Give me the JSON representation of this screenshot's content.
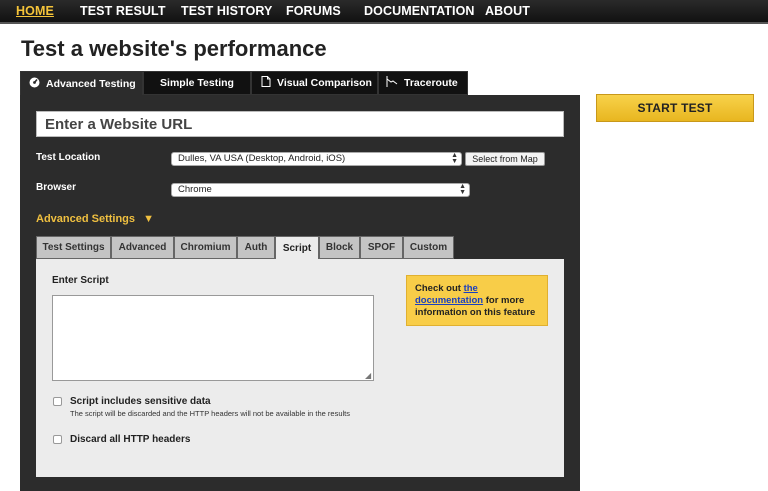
{
  "nav": {
    "items": [
      "HOME",
      "TEST RESULT",
      "TEST HISTORY",
      "FORUMS",
      "DOCUMENTATION",
      "ABOUT"
    ]
  },
  "page": {
    "title": "Test a website's performance"
  },
  "main_tabs": [
    {
      "label": "Advanced Testing",
      "icon": "gauge-icon",
      "active": true
    },
    {
      "label": "Simple Testing",
      "icon": "",
      "active": false
    },
    {
      "label": "Visual Comparison",
      "icon": "document-icon",
      "active": false
    },
    {
      "label": "Traceroute",
      "icon": "traceroute-icon",
      "active": false
    }
  ],
  "form": {
    "url_placeholder": "Enter a Website URL",
    "location_label": "Test Location",
    "location_value": "Dulles, VA USA (Desktop, Android, iOS)",
    "select_from_map": "Select from Map",
    "browser_label": "Browser",
    "browser_value": "Chrome",
    "advanced_settings": "Advanced Settings",
    "advanced_arrow": "▼"
  },
  "sub_tabs": [
    "Test Settings",
    "Advanced",
    "Chromium",
    "Auth",
    "Script",
    "Block",
    "SPOF",
    "Custom"
  ],
  "active_sub_tab": "Script",
  "script": {
    "label": "Enter Script",
    "value": "",
    "info_prefix": "Check out ",
    "info_link_1": "the",
    "info_link_2": "documentation",
    "info_suffix_1": " for more",
    "info_suffix_2": "information on this feature",
    "sensitive_label": "Script includes sensitive data",
    "sensitive_note": "The script will be discarded and the HTTP headers will not be available in the results",
    "discard_label": "Discard all HTTP headers"
  },
  "start_test": "START TEST",
  "colors": {
    "accent": "#f5c43a",
    "panel": "#2c2c2c",
    "info_bg": "#f8cd48"
  }
}
